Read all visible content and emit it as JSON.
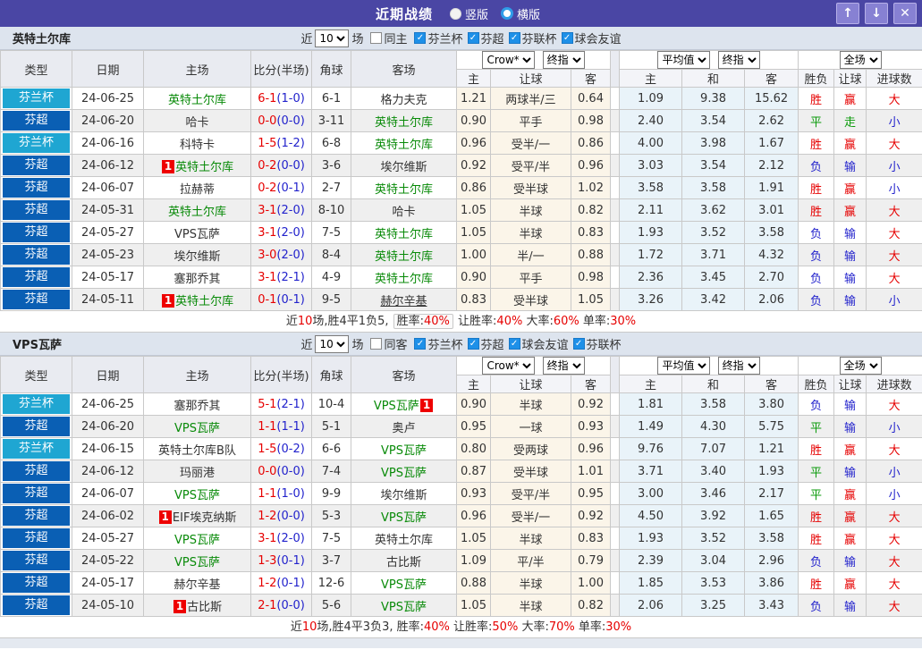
{
  "icons": {
    "check": "✓",
    "badge": "1",
    "up_arrow": "↑",
    "down_arrow": "↓",
    "close": "✕"
  },
  "titlebar": {
    "title": "近期战绩",
    "vertical_label": "竖版",
    "horizontal_label": "横版"
  },
  "filter": {
    "near_label": "近",
    "count": "10",
    "matches_label": "场"
  },
  "columns": {
    "type": "类型",
    "date": "日期",
    "home": "主场",
    "score": "比分(半场)",
    "corner": "角球",
    "away": "客场",
    "select_crow": "Crow*",
    "select_final": "终指",
    "select_avg": "平均值",
    "select_full": "全场",
    "hcp_home": "主",
    "hcp_line": "让球",
    "hcp_away": "客",
    "avg_home": "主",
    "avg_draw": "和",
    "avg_away": "客",
    "res_wdl": "胜负",
    "res_hcp": "让球",
    "res_goals": "进球数"
  },
  "colors": {
    "titlebar": "#4a46a4",
    "cup_badge": "#1fa6d2",
    "league_badge": "#0a5fb4",
    "win_red": "#e60000",
    "draw_green": "#0a9a0a",
    "lose_blue": "#2222cc",
    "team_green": "#088a08"
  },
  "tables": [
    {
      "team": "英特土尔库",
      "same_label": "同主",
      "leagues": [
        "芬兰杯",
        "芬超",
        "芬联杯",
        "球会友谊"
      ],
      "rows": [
        {
          "type": "芬兰杯",
          "date": "24-06-25",
          "home": {
            "name": "英特土尔库",
            "green": true
          },
          "score": "6-1",
          "half": "(1-0)",
          "corner": "6-1",
          "away": {
            "name": "格力夫克"
          },
          "odds": [
            "1.21",
            "两球半/三",
            "0.64"
          ],
          "avg": [
            "1.09",
            "9.38",
            "15.62"
          ],
          "result": [
            "胜",
            "赢",
            "大"
          ]
        },
        {
          "type": "芬超",
          "date": "24-06-20",
          "home": {
            "name": "哈卡"
          },
          "score": "0-0",
          "half": "(0-0)",
          "corner": "3-11",
          "away": {
            "name": "英特土尔库",
            "green": true
          },
          "odds": [
            "0.90",
            "平手",
            "0.98"
          ],
          "avg": [
            "2.40",
            "3.54",
            "2.62"
          ],
          "result": [
            "平",
            "走",
            "小"
          ]
        },
        {
          "type": "芬兰杯",
          "date": "24-06-16",
          "home": {
            "name": "科特卡"
          },
          "score": "1-5",
          "half": "(1-2)",
          "corner": "6-8",
          "away": {
            "name": "英特土尔库",
            "green": true
          },
          "odds": [
            "0.96",
            "受半/一",
            "0.86"
          ],
          "avg": [
            "4.00",
            "3.98",
            "1.67"
          ],
          "result": [
            "胜",
            "赢",
            "大"
          ]
        },
        {
          "type": "芬超",
          "date": "24-06-12",
          "home": {
            "name": "英特土尔库",
            "green": true,
            "badge": "before"
          },
          "score": "0-2",
          "half": "(0-0)",
          "corner": "3-6",
          "away": {
            "name": "埃尔维斯"
          },
          "odds": [
            "0.92",
            "受平/半",
            "0.96"
          ],
          "avg": [
            "3.03",
            "3.54",
            "2.12"
          ],
          "result": [
            "负",
            "输",
            "小"
          ]
        },
        {
          "type": "芬超",
          "date": "24-06-07",
          "home": {
            "name": "拉赫蒂"
          },
          "score": "0-2",
          "half": "(0-1)",
          "corner": "2-7",
          "away": {
            "name": "英特土尔库",
            "green": true
          },
          "odds": [
            "0.86",
            "受半球",
            "1.02"
          ],
          "avg": [
            "3.58",
            "3.58",
            "1.91"
          ],
          "result": [
            "胜",
            "赢",
            "小"
          ]
        },
        {
          "type": "芬超",
          "date": "24-05-31",
          "home": {
            "name": "英特土尔库",
            "green": true
          },
          "score": "3-1",
          "half": "(2-0)",
          "corner": "8-10",
          "away": {
            "name": "哈卡"
          },
          "odds": [
            "1.05",
            "半球",
            "0.82"
          ],
          "avg": [
            "2.11",
            "3.62",
            "3.01"
          ],
          "result": [
            "胜",
            "赢",
            "大"
          ]
        },
        {
          "type": "芬超",
          "date": "24-05-27",
          "home": {
            "name": "VPS瓦萨"
          },
          "score": "3-1",
          "half": "(2-0)",
          "corner": "7-5",
          "away": {
            "name": "英特土尔库",
            "green": true
          },
          "odds": [
            "1.05",
            "半球",
            "0.83"
          ],
          "avg": [
            "1.93",
            "3.52",
            "3.58"
          ],
          "result": [
            "负",
            "输",
            "大"
          ]
        },
        {
          "type": "芬超",
          "date": "24-05-23",
          "home": {
            "name": "埃尔维斯"
          },
          "score": "3-0",
          "half": "(2-0)",
          "corner": "8-4",
          "away": {
            "name": "英特土尔库",
            "green": true
          },
          "odds": [
            "1.00",
            "半/一",
            "0.88"
          ],
          "avg": [
            "1.72",
            "3.71",
            "4.32"
          ],
          "result": [
            "负",
            "输",
            "大"
          ]
        },
        {
          "type": "芬超",
          "date": "24-05-17",
          "home": {
            "name": "塞那乔其"
          },
          "score": "3-1",
          "half": "(2-1)",
          "corner": "4-9",
          "away": {
            "name": "英特土尔库",
            "green": true
          },
          "odds": [
            "0.90",
            "平手",
            "0.98"
          ],
          "avg": [
            "2.36",
            "3.45",
            "2.70"
          ],
          "result": [
            "负",
            "输",
            "大"
          ]
        },
        {
          "type": "芬超",
          "date": "24-05-11",
          "home": {
            "name": "英特土尔库",
            "green": true,
            "badge": "before"
          },
          "score": "0-1",
          "half": "(0-1)",
          "corner": "9-5",
          "away": {
            "name": "赫尔辛基",
            "underline": true
          },
          "odds": [
            "0.83",
            "受半球",
            "1.05"
          ],
          "avg": [
            "3.26",
            "3.42",
            "2.06"
          ],
          "result": [
            "负",
            "输",
            "小"
          ]
        }
      ],
      "summary": [
        {
          "t": "近"
        },
        {
          "t": "10",
          "red": true
        },
        {
          "t": "场,胜4平1负5, "
        },
        {
          "box": [
            {
              "t": "胜率:"
            },
            {
              "t": "40%",
              "red": true
            }
          ]
        },
        {
          "t": " 让胜率:"
        },
        {
          "t": "40%",
          "red": true
        },
        {
          "t": " 大率:"
        },
        {
          "t": "60%",
          "red": true
        },
        {
          "t": " 单率:"
        },
        {
          "t": "30%",
          "red": true
        }
      ]
    },
    {
      "team": "VPS瓦萨",
      "same_label": "同客",
      "leagues": [
        "芬兰杯",
        "芬超",
        "球会友谊",
        "芬联杯"
      ],
      "rows": [
        {
          "type": "芬兰杯",
          "date": "24-06-25",
          "home": {
            "name": "塞那乔其"
          },
          "score": "5-1",
          "half": "(2-1)",
          "corner": "10-4",
          "away": {
            "name": "VPS瓦萨",
            "green": true,
            "badge": "after"
          },
          "odds": [
            "0.90",
            "半球",
            "0.92"
          ],
          "avg": [
            "1.81",
            "3.58",
            "3.80"
          ],
          "result": [
            "负",
            "输",
            "大"
          ]
        },
        {
          "type": "芬超",
          "date": "24-06-20",
          "home": {
            "name": "VPS瓦萨",
            "green": true
          },
          "score": "1-1",
          "half": "(1-1)",
          "corner": "5-1",
          "away": {
            "name": "奥卢"
          },
          "odds": [
            "0.95",
            "一球",
            "0.93"
          ],
          "avg": [
            "1.49",
            "4.30",
            "5.75"
          ],
          "result": [
            "平",
            "输",
            "小"
          ]
        },
        {
          "type": "芬兰杯",
          "date": "24-06-15",
          "home": {
            "name": "英特土尔库B队"
          },
          "score": "1-5",
          "half": "(0-2)",
          "corner": "6-6",
          "away": {
            "name": "VPS瓦萨",
            "green": true
          },
          "odds": [
            "0.80",
            "受两球",
            "0.96"
          ],
          "avg": [
            "9.76",
            "7.07",
            "1.21"
          ],
          "result": [
            "胜",
            "赢",
            "大"
          ]
        },
        {
          "type": "芬超",
          "date": "24-06-12",
          "home": {
            "name": "玛丽港"
          },
          "score": "0-0",
          "half": "(0-0)",
          "corner": "7-4",
          "away": {
            "name": "VPS瓦萨",
            "green": true
          },
          "odds": [
            "0.87",
            "受半球",
            "1.01"
          ],
          "avg": [
            "3.71",
            "3.40",
            "1.93"
          ],
          "result": [
            "平",
            "输",
            "小"
          ]
        },
        {
          "type": "芬超",
          "date": "24-06-07",
          "home": {
            "name": "VPS瓦萨",
            "green": true
          },
          "score": "1-1",
          "half": "(1-0)",
          "corner": "9-9",
          "away": {
            "name": "埃尔维斯"
          },
          "odds": [
            "0.93",
            "受平/半",
            "0.95"
          ],
          "avg": [
            "3.00",
            "3.46",
            "2.17"
          ],
          "result": [
            "平",
            "赢",
            "小"
          ]
        },
        {
          "type": "芬超",
          "date": "24-06-02",
          "home": {
            "name": "EIF埃克纳斯",
            "badge": "before"
          },
          "score": "1-2",
          "half": "(0-0)",
          "corner": "5-3",
          "away": {
            "name": "VPS瓦萨",
            "green": true
          },
          "odds": [
            "0.96",
            "受半/一",
            "0.92"
          ],
          "avg": [
            "4.50",
            "3.92",
            "1.65"
          ],
          "result": [
            "胜",
            "赢",
            "大"
          ]
        },
        {
          "type": "芬超",
          "date": "24-05-27",
          "home": {
            "name": "VPS瓦萨",
            "green": true
          },
          "score": "3-1",
          "half": "(2-0)",
          "corner": "7-5",
          "away": {
            "name": "英特土尔库"
          },
          "odds": [
            "1.05",
            "半球",
            "0.83"
          ],
          "avg": [
            "1.93",
            "3.52",
            "3.58"
          ],
          "result": [
            "胜",
            "赢",
            "大"
          ]
        },
        {
          "type": "芬超",
          "date": "24-05-22",
          "home": {
            "name": "VPS瓦萨",
            "green": true
          },
          "score": "1-3",
          "half": "(0-1)",
          "corner": "3-7",
          "away": {
            "name": "古比斯"
          },
          "odds": [
            "1.09",
            "平/半",
            "0.79"
          ],
          "avg": [
            "2.39",
            "3.04",
            "2.96"
          ],
          "result": [
            "负",
            "输",
            "大"
          ]
        },
        {
          "type": "芬超",
          "date": "24-05-17",
          "home": {
            "name": "赫尔辛基"
          },
          "score": "1-2",
          "half": "(0-1)",
          "corner": "12-6",
          "away": {
            "name": "VPS瓦萨",
            "green": true
          },
          "odds": [
            "0.88",
            "半球",
            "1.00"
          ],
          "avg": [
            "1.85",
            "3.53",
            "3.86"
          ],
          "result": [
            "胜",
            "赢",
            "大"
          ]
        },
        {
          "type": "芬超",
          "date": "24-05-10",
          "home": {
            "name": "古比斯",
            "badge": "before"
          },
          "score": "2-1",
          "half": "(0-0)",
          "corner": "5-6",
          "away": {
            "name": "VPS瓦萨",
            "green": true
          },
          "odds": [
            "1.05",
            "半球",
            "0.82"
          ],
          "avg": [
            "2.06",
            "3.25",
            "3.43"
          ],
          "result": [
            "负",
            "输",
            "大"
          ]
        }
      ],
      "summary": [
        {
          "t": "近"
        },
        {
          "t": "10",
          "red": true
        },
        {
          "t": "场,胜4平3负3, 胜率:"
        },
        {
          "t": "40%",
          "red": true
        },
        {
          "t": " 让胜率:"
        },
        {
          "t": "50%",
          "red": true
        },
        {
          "t": " 大率:"
        },
        {
          "t": "70%",
          "red": true
        },
        {
          "t": " 单率:"
        },
        {
          "t": "30%",
          "red": true
        }
      ]
    }
  ]
}
